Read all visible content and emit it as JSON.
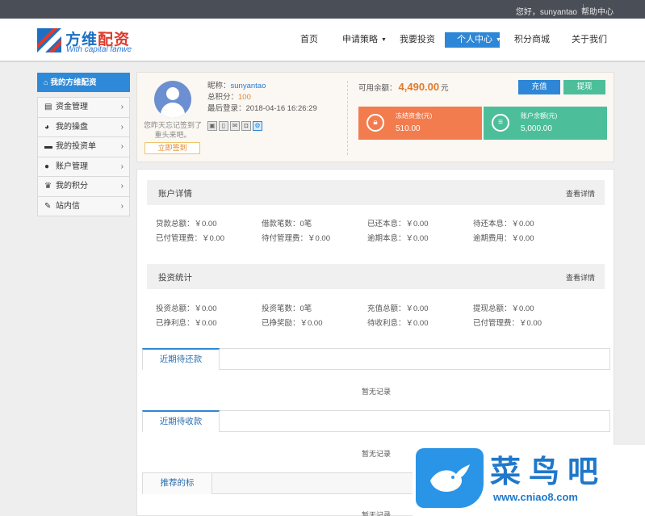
{
  "topbar": {
    "greeting": "您好，sunyantao",
    "help": "帮助中心"
  },
  "logo": {
    "name_blue": "方维",
    "name_red": "配资",
    "slogan": "With capital fanwe"
  },
  "nav": {
    "items": [
      "首页",
      "申请策略",
      "我要投资",
      "个人中心",
      "积分商城",
      "关于我们"
    ],
    "active": "个人中心"
  },
  "sidebar": {
    "title": "我的方维配资",
    "items": [
      {
        "label": "资金管理",
        "icon": "money-icon"
      },
      {
        "label": "我的操盘",
        "icon": "chart-pie-icon"
      },
      {
        "label": "我的投资单",
        "icon": "wallet-icon"
      },
      {
        "label": "账户管理",
        "icon": "user-icon"
      },
      {
        "label": "我的积分",
        "icon": "crown-icon"
      },
      {
        "label": "站内信",
        "icon": "message-icon"
      }
    ]
  },
  "profile": {
    "nickname_label": "昵称：",
    "nickname": "sunyantao",
    "points_label": "总积分：",
    "points": "100",
    "last_login_label": "最后登录：",
    "last_login": "2018-04-16 16:26:29",
    "sign_msg": "您昨天忘记签到了重头来吧。",
    "sign_button": "立即签到",
    "balance_label": "可用余额：",
    "balance": "4,490.00",
    "balance_unit": "元",
    "recharge": "充值",
    "withdraw": "提现",
    "frozen_label": "冻结资金(元)",
    "frozen_value": "510.00",
    "account_label": "账户余额(元)",
    "account_value": "5,000.00"
  },
  "account_details": {
    "title": "账户详情",
    "more": "查看详情",
    "stats": [
      "贷款总额：￥0.00",
      "借款笔数：0笔",
      "已还本息：￥0.00",
      "待还本息：￥0.00",
      "已付管理费：￥0.00",
      "待付管理费：￥0.00",
      "逾期本息：￥0.00",
      "逾期费用：￥0.00"
    ]
  },
  "investment_stats": {
    "title": "投资统计",
    "more": "查看详情",
    "stats": [
      "投资总额：￥0.00",
      "投资笔数：0笔",
      "充值总额：￥0.00",
      "提现总额：￥0.00",
      "已挣利息：￥0.00",
      "已挣奖励：￥0.00",
      "待收利息：￥0.00",
      "已付管理费：￥0.00"
    ]
  },
  "tabs": {
    "repay": "近期待还款",
    "receive": "近期待收款",
    "recommend": "推荐的标",
    "empty": "暂无记录"
  },
  "watermark": {
    "title": "菜鸟吧",
    "url": "www.cniao8.com"
  }
}
